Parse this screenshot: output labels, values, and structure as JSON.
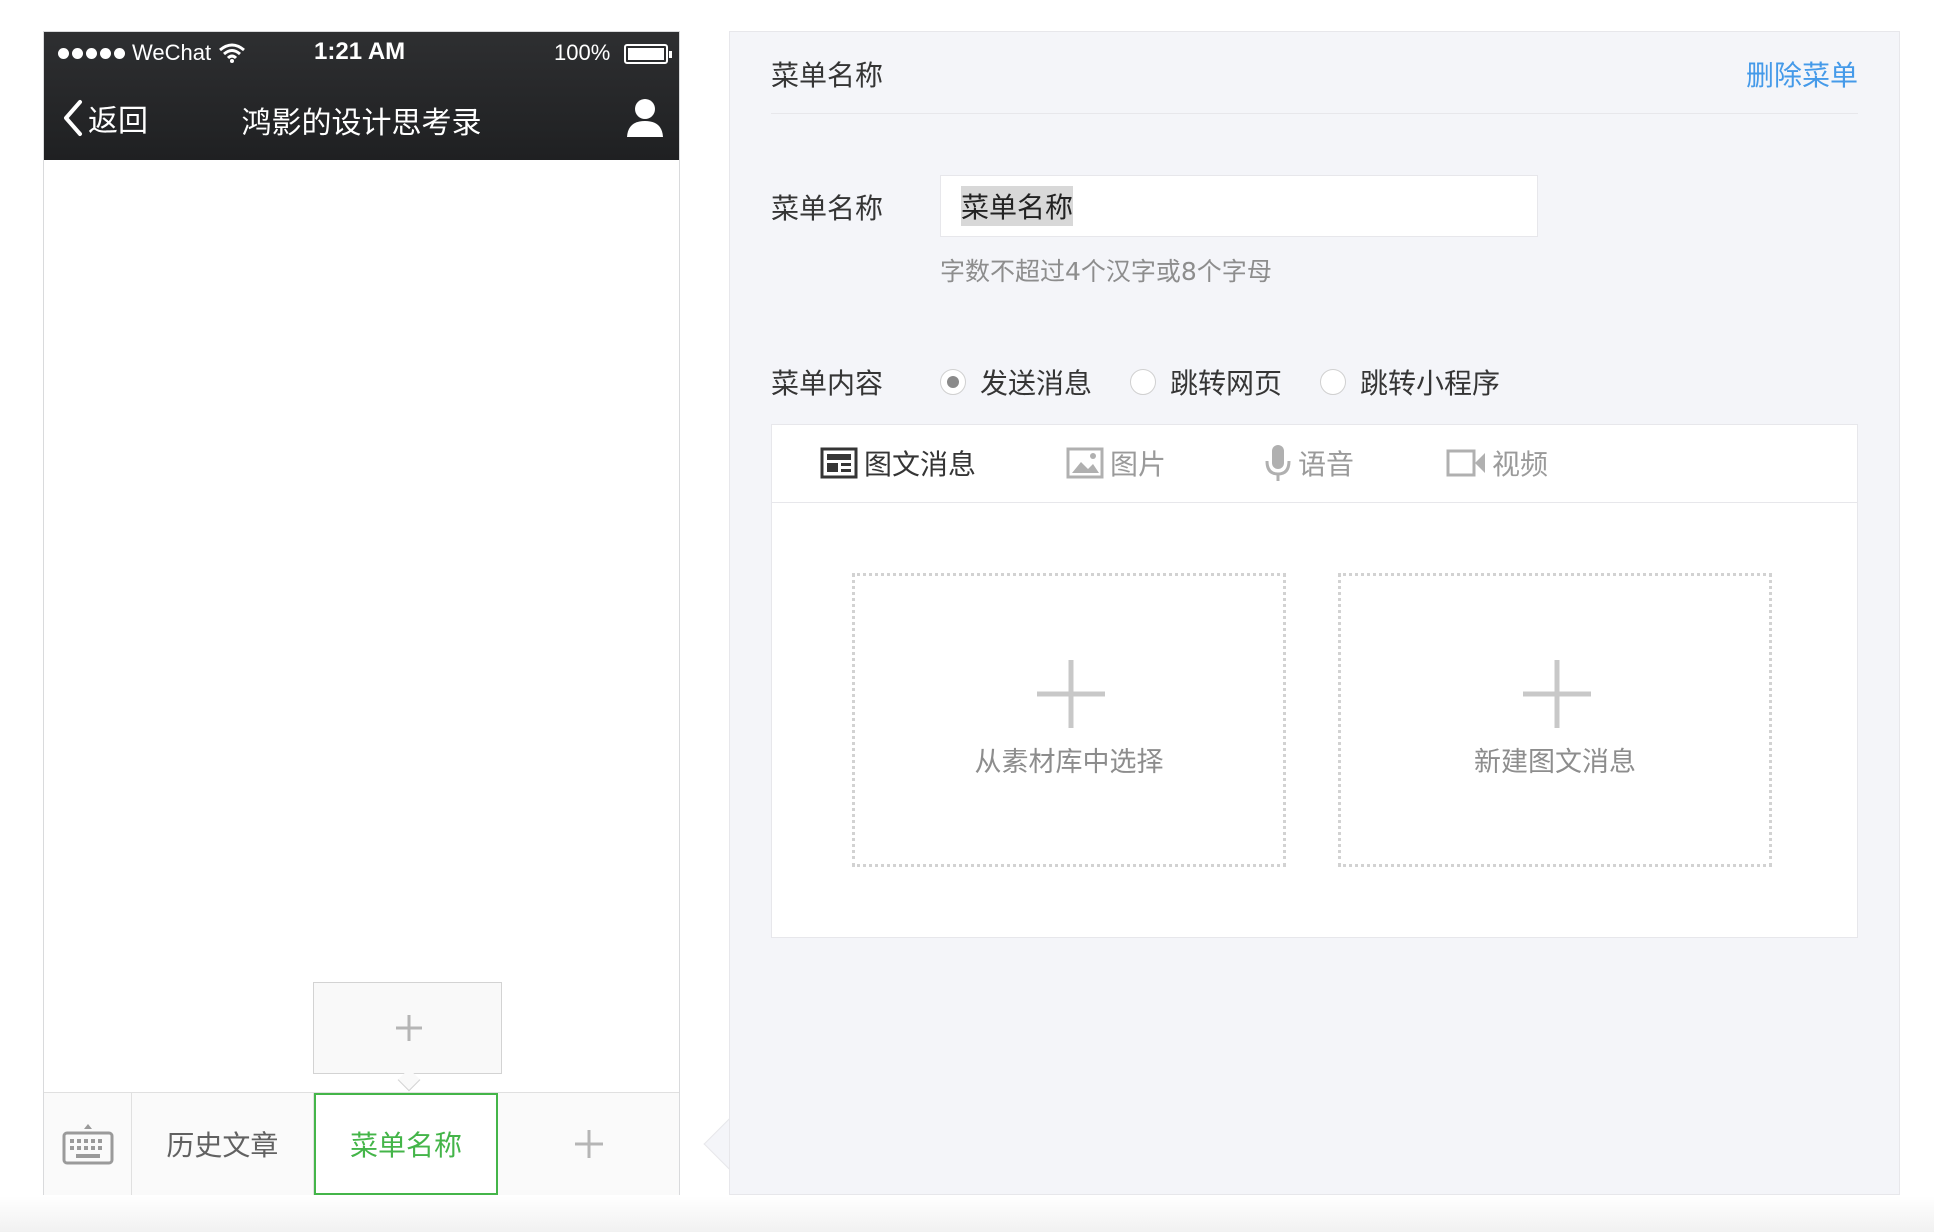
{
  "status_bar": {
    "carrier": "WeChat",
    "time": "1:21 AM",
    "battery": "100%"
  },
  "nav": {
    "back_label": "返回",
    "title": "鸿影的设计思考录"
  },
  "menu_bar": {
    "items": [
      {
        "label": "历史文章"
      },
      {
        "label": "菜单名称"
      }
    ]
  },
  "editor": {
    "header_title": "菜单名称",
    "delete_label": "删除菜单",
    "name_field": {
      "label": "菜单名称",
      "value": "菜单名称",
      "hint": "字数不超过4个汉字或8个字母"
    },
    "content_field": {
      "label": "菜单内容",
      "options": [
        {
          "label": "发送消息",
          "checked": true
        },
        {
          "label": "跳转网页",
          "checked": false
        },
        {
          "label": "跳转小程序",
          "checked": false
        }
      ]
    },
    "tabs": [
      {
        "label": "图文消息",
        "icon": "news-icon",
        "active": true
      },
      {
        "label": "图片",
        "icon": "image-icon",
        "active": false
      },
      {
        "label": "语音",
        "icon": "microphone-icon",
        "active": false
      },
      {
        "label": "视频",
        "icon": "video-icon",
        "active": false
      }
    ],
    "choices": [
      {
        "label": "从素材库中选择"
      },
      {
        "label": "新建图文消息"
      }
    ]
  },
  "colors": {
    "accent_green": "#44b549",
    "link_blue": "#459ae9",
    "panel_bg": "#f4f5f9"
  }
}
